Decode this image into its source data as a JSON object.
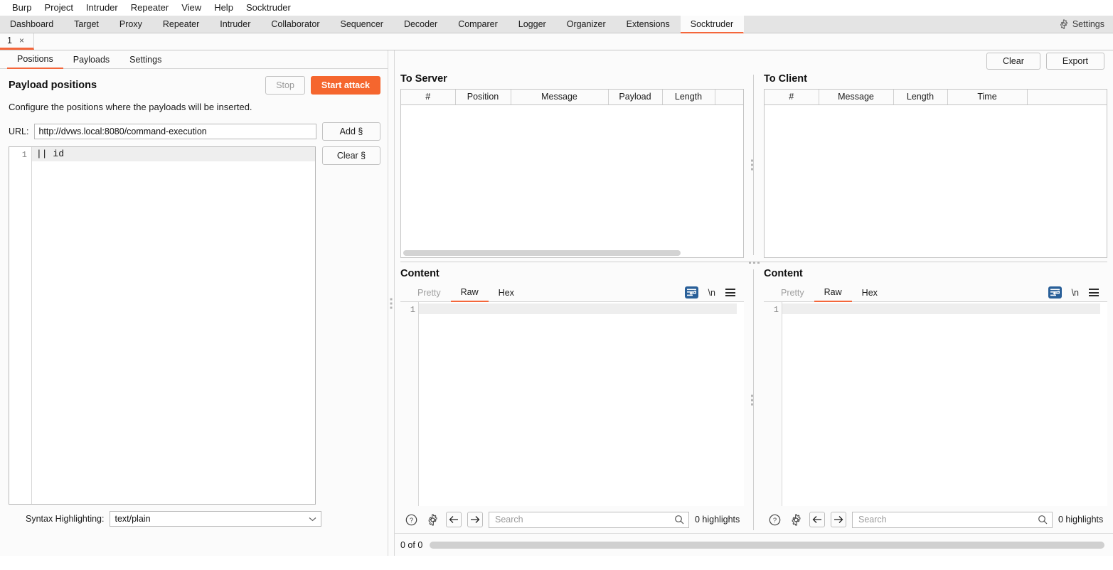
{
  "menubar": {
    "items": [
      {
        "label": "Burp"
      },
      {
        "label": "Project"
      },
      {
        "label": "Intruder"
      },
      {
        "label": "Repeater"
      },
      {
        "label": "View"
      },
      {
        "label": "Help"
      },
      {
        "label": "Socktruder"
      }
    ]
  },
  "top_tabs": {
    "items": [
      {
        "label": "Dashboard",
        "active": false
      },
      {
        "label": "Target",
        "active": false
      },
      {
        "label": "Proxy",
        "active": false
      },
      {
        "label": "Repeater",
        "active": false
      },
      {
        "label": "Intruder",
        "active": false
      },
      {
        "label": "Collaborator",
        "active": false
      },
      {
        "label": "Sequencer",
        "active": false
      },
      {
        "label": "Decoder",
        "active": false
      },
      {
        "label": "Comparer",
        "active": false
      },
      {
        "label": "Logger",
        "active": false
      },
      {
        "label": "Organizer",
        "active": false
      },
      {
        "label": "Extensions",
        "active": false
      },
      {
        "label": "Socktruder",
        "active": true
      }
    ],
    "settings_label": "Settings",
    "settings_icon": "gear-icon"
  },
  "attack_tabs": {
    "items": [
      {
        "label": "1",
        "close": "×"
      }
    ]
  },
  "left_pane": {
    "sub_tabs": [
      {
        "label": "Positions",
        "active": true
      },
      {
        "label": "Payloads",
        "active": false
      },
      {
        "label": "Settings",
        "active": false
      }
    ],
    "panel_title": "Payload positions",
    "stop_label": "Stop",
    "start_attack_label": "Start attack",
    "description": "Configure the positions where the payloads will be inserted.",
    "url_label": "URL:",
    "url_value": "http://dvws.local:8080/command-execution",
    "url_placeholder": "",
    "add_section_label": "Add §",
    "clear_section_label": "Clear §",
    "editor": {
      "line_numbers": [
        "1"
      ],
      "lines": [
        "|| id"
      ]
    },
    "syntax_label": "Syntax Highlighting:",
    "syntax_value": "text/plain",
    "syntax_options": [
      "text/plain"
    ],
    "chevron_icon": "chevron-down-icon"
  },
  "right_pane": {
    "toolbar": {
      "clear_label": "Clear",
      "export_label": "Export"
    },
    "to_server": {
      "title": "To Server",
      "columns": [
        "#",
        "Position",
        "Message",
        "Payload",
        "Length",
        ""
      ],
      "rows": []
    },
    "to_client": {
      "title": "To Client",
      "columns": [
        "#",
        "Message",
        "Length",
        "Time",
        ""
      ],
      "rows": []
    },
    "content_left": {
      "title": "Content",
      "tabs": [
        {
          "label": "Pretty",
          "active": false,
          "muted": true
        },
        {
          "label": "Raw",
          "active": true,
          "muted": false
        },
        {
          "label": "Hex",
          "active": false,
          "muted": false
        }
      ],
      "wrap_icon": "word-wrap-icon",
      "newline_icon": "\\n",
      "menu_icon": "hamburger-menu-icon",
      "line_numbers": [
        "1"
      ],
      "lines": [
        ""
      ],
      "help_icon": "help-circle-icon",
      "settings_icon": "gear-icon",
      "prev_icon": "arrow-left-icon",
      "next_icon": "arrow-right-icon",
      "search_placeholder": "Search",
      "search_value": "",
      "search_icon": "magnifier-icon",
      "highlights_label": "0 highlights"
    },
    "content_right": {
      "title": "Content",
      "tabs": [
        {
          "label": "Pretty",
          "active": false,
          "muted": true
        },
        {
          "label": "Raw",
          "active": true,
          "muted": false
        },
        {
          "label": "Hex",
          "active": false,
          "muted": false
        }
      ],
      "wrap_icon": "word-wrap-icon",
      "newline_icon": "\\n",
      "menu_icon": "hamburger-menu-icon",
      "line_numbers": [
        "1"
      ],
      "lines": [
        ""
      ],
      "help_icon": "help-circle-icon",
      "settings_icon": "gear-icon",
      "prev_icon": "arrow-left-icon",
      "next_icon": "arrow-right-icon",
      "search_placeholder": "Search",
      "search_value": "",
      "search_icon": "magnifier-icon",
      "highlights_label": "0 highlights"
    },
    "status": {
      "count_label": "0 of 0"
    }
  },
  "colors": {
    "accent": "#f5662e",
    "tab_underline": "#f4663a",
    "wrap_icon_bg": "#2a6099",
    "panel_bg": "#fbfbfb",
    "tabstrip_bg": "#e4e4e4",
    "border": "#c4c4c4"
  }
}
